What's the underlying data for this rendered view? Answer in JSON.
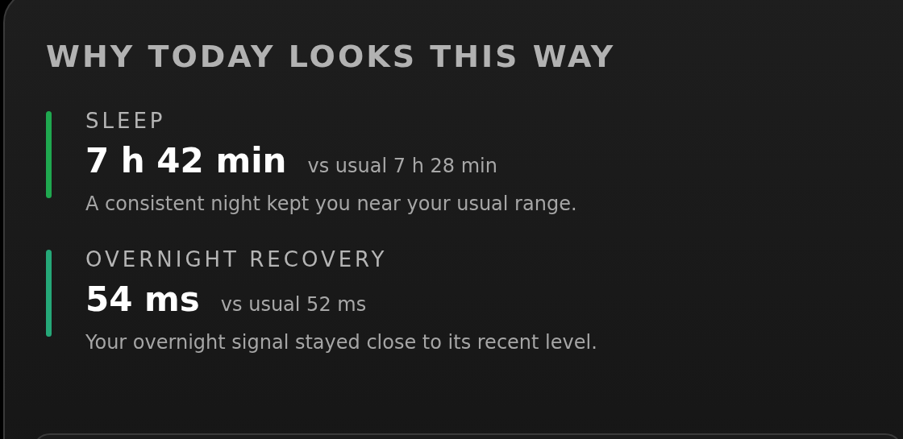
{
  "card": {
    "title": "WHY TODAY LOOKS THIS WAY",
    "factors": [
      {
        "label": "SLEEP",
        "value": "7 h 42 min",
        "comparison": "vs usual 7 h 28 min",
        "description": "A consistent night kept you near your usual range.",
        "color": "#1fa84f"
      },
      {
        "label": "OVERNIGHT RECOVERY",
        "value": "54 ms",
        "comparison": "vs usual 52 ms",
        "description": "Your overnight signal stayed close to its recent level.",
        "color": "#25a878"
      }
    ]
  }
}
